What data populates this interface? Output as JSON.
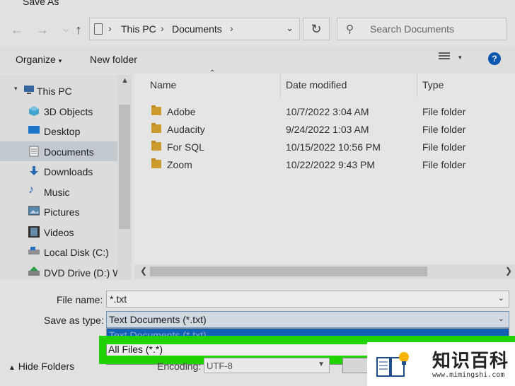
{
  "window": {
    "title": "Save As"
  },
  "nav": {
    "back_icon": "arrow-left-icon",
    "forward_icon": "arrow-right-icon",
    "up_icon": "arrow-up-icon",
    "breadcrumbs": [
      "This PC",
      "Documents"
    ],
    "refresh_icon": "refresh-icon"
  },
  "search": {
    "placeholder": "Search Documents"
  },
  "toolbar": {
    "organize_label": "Organize",
    "new_folder_label": "New folder"
  },
  "sidebar": {
    "items": [
      {
        "label": "This PC",
        "icon": "computer-icon"
      },
      {
        "label": "3D Objects",
        "icon": "cube-icon"
      },
      {
        "label": "Desktop",
        "icon": "desktop-icon"
      },
      {
        "label": "Documents",
        "icon": "document-icon",
        "selected": true
      },
      {
        "label": "Downloads",
        "icon": "download-icon"
      },
      {
        "label": "Music",
        "icon": "music-icon"
      },
      {
        "label": "Pictures",
        "icon": "picture-icon"
      },
      {
        "label": "Videos",
        "icon": "video-icon"
      },
      {
        "label": "Local Disk (C:)",
        "icon": "drive-icon"
      },
      {
        "label": "DVD Drive (D:) W",
        "icon": "dvd-icon"
      }
    ]
  },
  "files": {
    "columns": {
      "name": "Name",
      "date": "Date modified",
      "type": "Type"
    },
    "rows": [
      {
        "name": "Adobe",
        "date": "10/7/2022 3:04 AM",
        "type": "File folder"
      },
      {
        "name": "Audacity",
        "date": "9/24/2022 1:03 AM",
        "type": "File folder"
      },
      {
        "name": "For SQL",
        "date": "10/15/2022 10:56 PM",
        "type": "File folder"
      },
      {
        "name": "Zoom",
        "date": "10/22/2022 9:43 PM",
        "type": "File folder"
      }
    ]
  },
  "form": {
    "file_name_label": "File name:",
    "file_name_value": "*.txt",
    "save_as_type_label": "Save as type:",
    "save_as_type_value": "Text Documents (*.txt)",
    "dropdown_options": [
      "Text Documents (*.txt)",
      "All Files  (*.*)"
    ],
    "encoding_label": "Encoding:",
    "encoding_value": "UTF-8",
    "hide_folders_label": "Hide Folders"
  },
  "watermark": {
    "title": "知识百科",
    "url": "www.mimingshi.com"
  },
  "colors": {
    "highlight": "#22e000",
    "selected_option": "#1565c0",
    "help": "#0a5eb8",
    "folder": "#d8a534"
  }
}
